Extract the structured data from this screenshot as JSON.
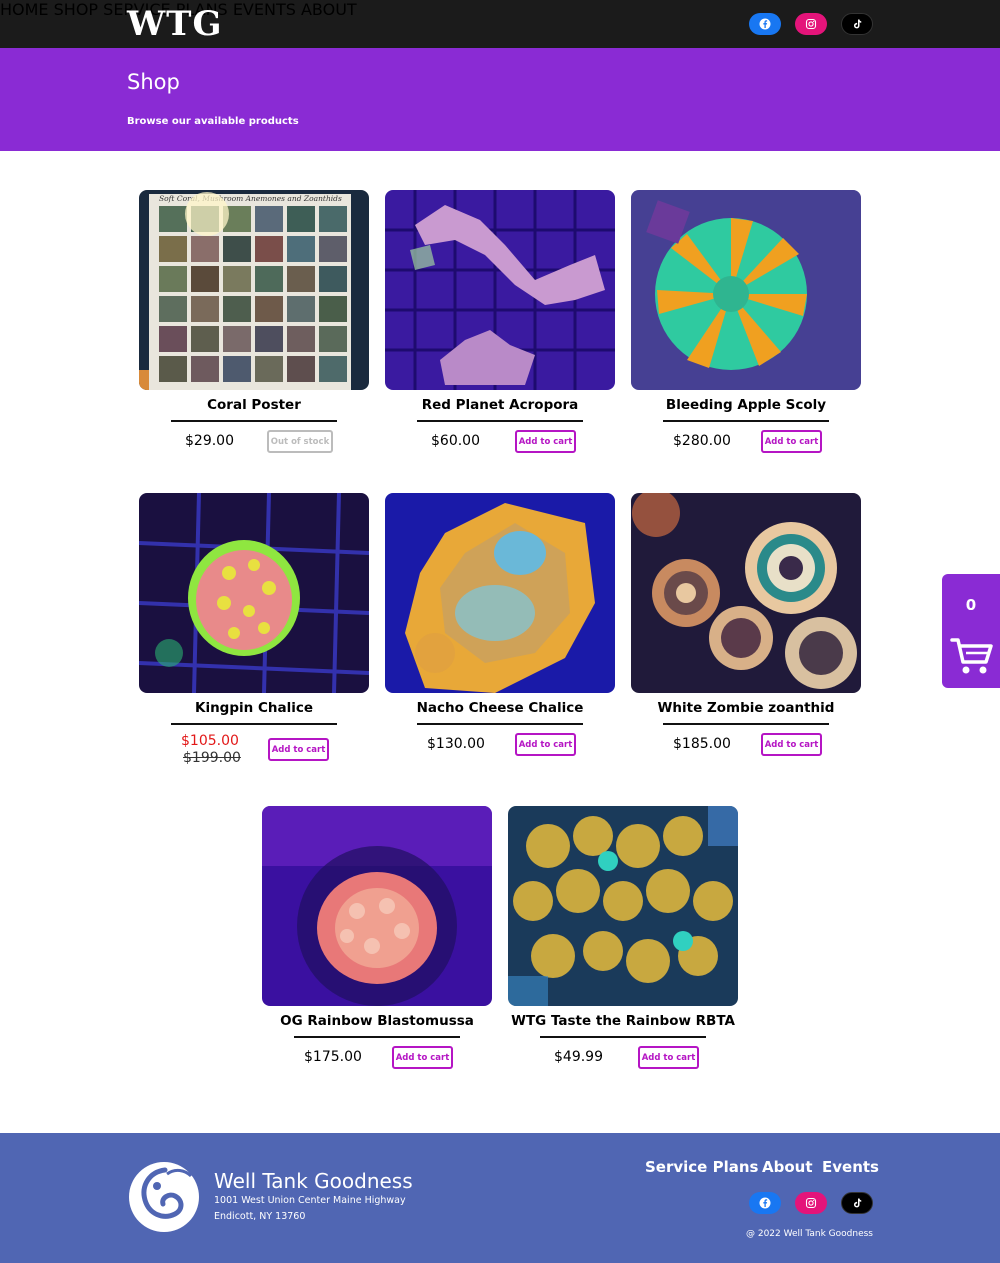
{
  "brand": {
    "logo_text": "WTG"
  },
  "nav": {
    "items": [
      {
        "label": "HOME"
      },
      {
        "label": "SHOP"
      },
      {
        "label": "SERVICE PLANS"
      },
      {
        "label": "EVENTS"
      },
      {
        "label": "ABOUT"
      }
    ],
    "social": [
      {
        "icon": "facebook-icon",
        "color": "#1877f2"
      },
      {
        "icon": "instagram-icon",
        "color": "#e4147a"
      },
      {
        "icon": "tiktok-icon",
        "color": "#000000"
      }
    ]
  },
  "hero": {
    "title": "Shop",
    "subtitle": "Browse our available products",
    "background": "#8a2bd4"
  },
  "products": [
    {
      "name": "Coral Poster",
      "price": "$29.00",
      "button": "Out of stock",
      "available": false
    },
    {
      "name": "Red Planet Acropora",
      "price": "$60.00",
      "button": "Add to cart",
      "available": true
    },
    {
      "name": "Bleeding Apple Scoly",
      "price": "$280.00",
      "button": "Add to cart",
      "available": true
    },
    {
      "name": "Kingpin Chalice",
      "price": "$105.00",
      "original_price": "$199.00",
      "button": "Add to cart",
      "available": true
    },
    {
      "name": "Nacho Cheese Chalice",
      "price": "$130.00",
      "button": "Add to cart",
      "available": true
    },
    {
      "name": "White Zombie zoanthid",
      "price": "$185.00",
      "button": "Add to cart",
      "available": true
    },
    {
      "name": "OG Rainbow Blastomussa",
      "price": "$175.00",
      "button": "Add to cart",
      "available": true
    },
    {
      "name": "WTG Taste the Rainbow RBTA",
      "price": "$49.99",
      "button": "Add to cart",
      "available": true
    }
  ],
  "poster_heading": "Soft Coral, Mushroom Anemones and Zoanthids",
  "cart": {
    "count": "0",
    "icon": "shopping-cart-icon"
  },
  "footer": {
    "brand": "Well Tank Goodness",
    "address_line1": "1001 West Union Center Maine Highway",
    "address_line2": "Endicott, NY 13760",
    "links": [
      {
        "label": "Service Plans"
      },
      {
        "label": "About"
      },
      {
        "label": "Events"
      }
    ],
    "copyright": "@ 2022 Well Tank Goodness",
    "background": "#5066b3"
  }
}
